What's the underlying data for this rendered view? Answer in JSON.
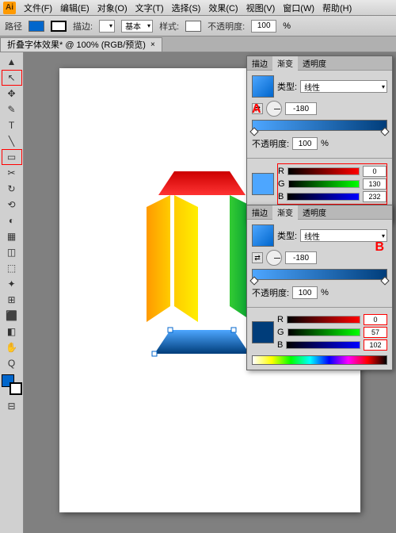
{
  "menubar": {
    "logo": "Ai",
    "items": [
      "文件(F)",
      "编辑(E)",
      "对象(O)",
      "文字(T)",
      "选择(S)",
      "效果(C)",
      "视图(V)",
      "窗口(W)",
      "帮助(H)"
    ]
  },
  "control": {
    "path_label": "路径",
    "stroke_label": "描边:",
    "basic_label": "基本",
    "style_label": "样式:",
    "opacity_label": "不透明度:",
    "opacity_value": "100",
    "pct": "%"
  },
  "tab": {
    "title": "折叠字体效果* @ 100% (RGB/预览)",
    "close": "×"
  },
  "panelA": {
    "tabs": [
      "描边",
      "渐变",
      "透明度"
    ],
    "type_label": "类型:",
    "type_value": "线性",
    "angle_value": "-180",
    "annotation": "A",
    "opacity_label": "不透明度:",
    "opacity_value": "100",
    "pct": "%",
    "rgb": {
      "r_label": "R",
      "g_label": "G",
      "b_label": "B",
      "r": "0",
      "g": "130",
      "b": "232"
    }
  },
  "panelB": {
    "tabs": [
      "描边",
      "渐变",
      "透明度"
    ],
    "type_label": "类型:",
    "type_value": "线性",
    "angle_value": "-180",
    "annotation": "B",
    "opacity_label": "不透明度:",
    "opacity_value": "100",
    "pct": "%",
    "rgb": {
      "r_label": "R",
      "g_label": "G",
      "b_label": "B",
      "r": "0",
      "g": "57",
      "b": "102"
    }
  },
  "tools": [
    "▲",
    "↖",
    "✥",
    "✎",
    "T",
    "╲",
    "▭",
    "✂",
    "↻",
    "⟲",
    "◐",
    "▦",
    "◫",
    "⬚",
    "✦",
    "⊞",
    "⬛",
    "◧",
    "⊡",
    "◈",
    "⬙",
    "✋",
    "Q",
    "⊟"
  ],
  "chart_data": {
    "type": "vector-illustration",
    "description": "Folded letter shape composed of colored trapezoids",
    "shapes": [
      {
        "name": "top-red",
        "color_start": "#cc0000",
        "color_end": "#ff3333",
        "approx_polygon": "trapezoid"
      },
      {
        "name": "left-orange",
        "color_start": "#ff9900",
        "color_end": "#ffcc00",
        "approx_polygon": "parallelogram"
      },
      {
        "name": "mid-yellow",
        "color_start": "#ffcc00",
        "color_end": "#ffee00",
        "approx_polygon": "parallelogram"
      },
      {
        "name": "right-green",
        "color_start": "#009933",
        "color_end": "#33cc33",
        "approx_polygon": "parallelogram"
      },
      {
        "name": "bottom-blue",
        "color_start": "#003d7a",
        "color_end": "#4da6ff",
        "approx_polygon": "trapezoid"
      }
    ]
  }
}
